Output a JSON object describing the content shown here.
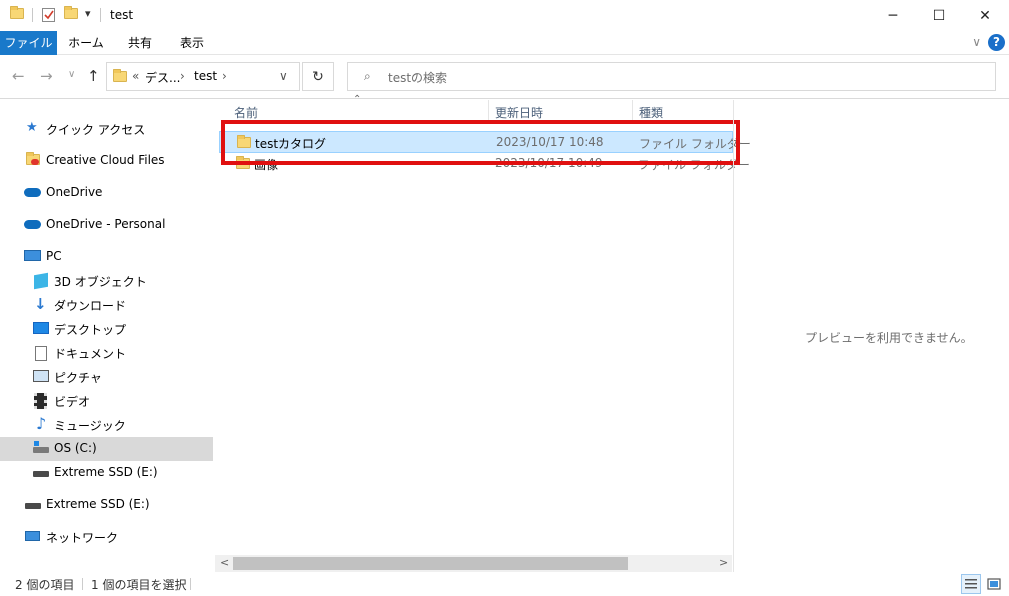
{
  "window": {
    "title": "test",
    "min_glyph": "─",
    "max_glyph": "☐",
    "close_glyph": "✕",
    "qat_dropdown_glyph": "▾"
  },
  "ribbon": {
    "tabs": [
      "ファイル",
      "ホーム",
      "共有",
      "表示"
    ],
    "expand_glyph": "∨",
    "help_glyph": "?",
    "accent": "#1979ca"
  },
  "nav": {
    "back_glyph": "←",
    "forward_glyph": "→",
    "recent_glyph": "∨",
    "up_glyph": "↑",
    "breadcrumb_overflow": "«",
    "breadcrumb": [
      "デス...",
      "test"
    ],
    "crumb_sep": "›",
    "address_dropdown_glyph": "∨",
    "refresh_glyph": "↻"
  },
  "search": {
    "icon": "search-icon",
    "glyph": "⌕",
    "placeholder": "testの検索"
  },
  "sidebar": {
    "items": [
      {
        "label": "クイック アクセス",
        "icon": "star-icon"
      },
      {
        "label": "Creative Cloud Files",
        "icon": "creative-cloud-folder-icon"
      },
      {
        "label": "OneDrive",
        "icon": "cloud-icon"
      },
      {
        "label": "OneDrive - Personal",
        "icon": "cloud-icon"
      },
      {
        "label": "PC",
        "icon": "pc-icon"
      },
      {
        "label": "3D オブジェクト",
        "icon": "3d-objects-icon"
      },
      {
        "label": "ダウンロード",
        "icon": "download-icon"
      },
      {
        "label": "デスクトップ",
        "icon": "desktop-icon"
      },
      {
        "label": "ドキュメント",
        "icon": "document-icon"
      },
      {
        "label": "ピクチャ",
        "icon": "picture-icon"
      },
      {
        "label": "ビデオ",
        "icon": "video-icon"
      },
      {
        "label": "ミュージック",
        "icon": "music-icon"
      },
      {
        "label": "OS (C:)",
        "icon": "drive-icon",
        "selected": true
      },
      {
        "label": "Extreme SSD (E:)",
        "icon": "usb-drive-icon"
      },
      {
        "label": "Extreme SSD (E:)",
        "icon": "usb-drive-icon"
      },
      {
        "label": "ネットワーク",
        "icon": "network-icon"
      }
    ]
  },
  "filelist": {
    "sort_glyph": "⌃",
    "columns": [
      "名前",
      "更新日時",
      "種類"
    ],
    "rows": [
      {
        "name": "testカタログ",
        "date": "2023/10/17 10:48",
        "type": "ファイル フォルダー",
        "selected": true
      },
      {
        "name": "画像",
        "date": "2023/10/17 10:49",
        "type": "ファイル フォルダー",
        "selected": false
      }
    ],
    "highlight_color": "#e01010",
    "scroll_left_glyph": "<",
    "scroll_right_glyph": ">"
  },
  "preview": {
    "message": "プレビューを利用できません。"
  },
  "status": {
    "item_count": "2 個の項目",
    "selected_count": "1 個の項目を選択"
  }
}
